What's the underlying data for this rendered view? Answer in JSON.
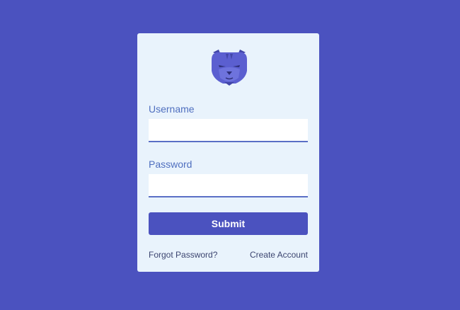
{
  "logo": {
    "icon": "panther-icon",
    "primary_color": "#5b5fd0",
    "shade_color": "#4246a8"
  },
  "form": {
    "username_label": "Username",
    "username_value": "",
    "password_label": "Password",
    "password_value": "",
    "submit_label": "Submit"
  },
  "links": {
    "forgot_password": "Forgot Password?",
    "create_account": "Create Account"
  },
  "colors": {
    "background": "#4b52bf",
    "card": "#e9f3fc",
    "accent": "#4b52bf",
    "label": "#4f6fbf"
  }
}
